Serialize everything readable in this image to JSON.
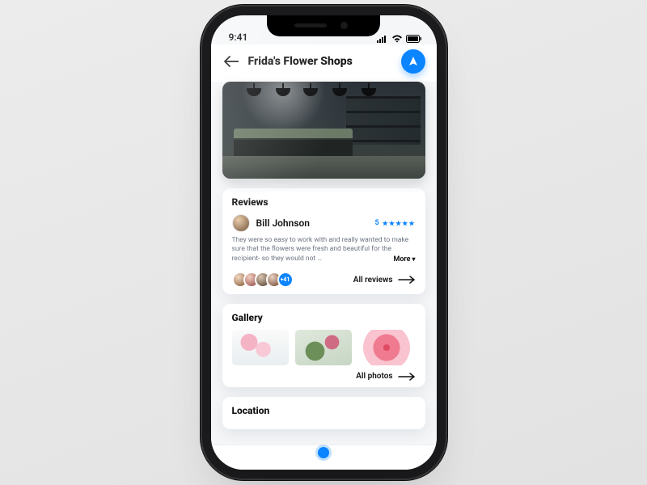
{
  "status": {
    "time": "9:41"
  },
  "header": {
    "title": "Frida's Flower Shops",
    "back_icon": "arrow-left",
    "action_icon": "navigation"
  },
  "reviews": {
    "heading": "Reviews",
    "featured": {
      "author": "Bill Johnson",
      "rating_value": "5",
      "rating_stars": "★★★★★",
      "body": "They were so easy to work with and really wanted to make sure that the flowers were fresh and beautiful for the recipient- so they  would not …",
      "more_label": "More"
    },
    "others_badge": "+41",
    "all_link": "All reviews"
  },
  "gallery": {
    "heading": "Gallery",
    "all_link": "All photos"
  },
  "location": {
    "heading": "Location"
  }
}
